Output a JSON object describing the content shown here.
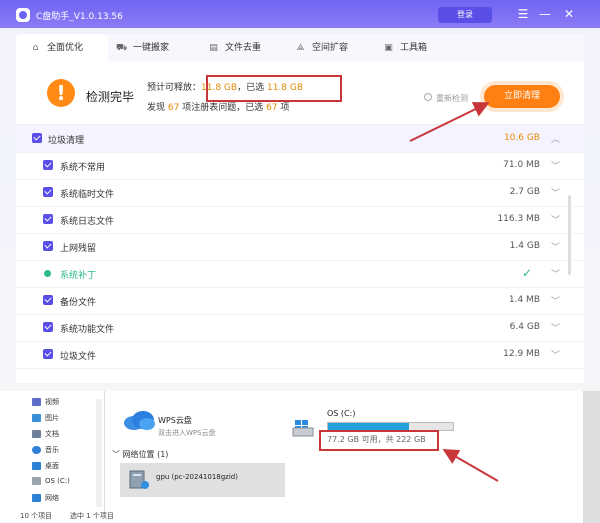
{
  "app": {
    "title": "C盘助手_V1.0.13.56",
    "login_label": "登录",
    "win_buttons": [
      "☰",
      "—",
      "✕"
    ],
    "brand_color": "#6d63f5",
    "accent_color": "#ff7f12"
  },
  "tabs": [
    {
      "label": "全面优化",
      "icon": "home-icon",
      "glyph": "⌂",
      "active": true
    },
    {
      "label": "一键搬家",
      "icon": "truck-icon",
      "glyph": "⛟",
      "active": false
    },
    {
      "label": "文件去重",
      "icon": "file-icon",
      "glyph": "▤",
      "active": false
    },
    {
      "label": "空间扩容",
      "icon": "expand-icon",
      "glyph": "⟁",
      "active": false
    },
    {
      "label": "工具箱",
      "icon": "toolbox-icon",
      "glyph": "▣",
      "active": false
    }
  ],
  "summary": {
    "done_label": "检测完毕",
    "line1": {
      "prefix": "预计可释放：",
      "amount": "11.8 GB",
      "sep": "，已选",
      "selected": "11.8 GB"
    },
    "line2": {
      "prefix": "发现 ",
      "count1": "67",
      "mid": " 项注册表问题，已选 ",
      "count2": "67",
      "suffix": " 项"
    },
    "rescan_label": "重新检测",
    "clean_label": "立即清理"
  },
  "items": [
    {
      "label": "垃圾清理",
      "size": "10.6 GB",
      "type": "cat",
      "chevron": "︿"
    },
    {
      "label": "系统不常用",
      "size": "71.0 MB",
      "type": "check",
      "chevron": "﹀"
    },
    {
      "label": "系统临时文件",
      "size": "2.7 GB",
      "type": "check",
      "chevron": "﹀"
    },
    {
      "label": "系统日志文件",
      "size": "116.3 MB",
      "type": "check",
      "chevron": "﹀"
    },
    {
      "label": "上网残留",
      "size": "1.4 GB",
      "type": "check",
      "chevron": "﹀"
    },
    {
      "label": "系统补丁",
      "size": "",
      "type": "done",
      "chevron": "﹀"
    },
    {
      "label": "备份文件",
      "size": "1.4 MB",
      "type": "check",
      "chevron": "﹀"
    },
    {
      "label": "系统功能文件",
      "size": "6.4 GB",
      "type": "check",
      "chevron": "﹀"
    },
    {
      "label": "垃圾文件",
      "size": "12.9 MB",
      "type": "check",
      "chevron": "﹀"
    }
  ],
  "explorer": {
    "nav": [
      {
        "label": "视频",
        "icon": "video-icon",
        "color": "#5b6cc9"
      },
      {
        "label": "图片",
        "icon": "picture-icon",
        "color": "#3a8fd8"
      },
      {
        "label": "文档",
        "icon": "document-icon",
        "color": "#6f7f9a"
      },
      {
        "label": "音乐",
        "icon": "music-icon",
        "color": "#2f7ed8"
      },
      {
        "label": "桌面",
        "icon": "desktop-icon",
        "color": "#2f7ed8"
      },
      {
        "label": "OS (C:)",
        "icon": "drive-icon",
        "color": "#9aa4ae"
      },
      {
        "label": "网络",
        "icon": "network-icon",
        "color": "#2f7ed8"
      }
    ],
    "wps_name": "WPS云盘",
    "wps_sub": "双击进入WPS云盘",
    "drive_name": "OS (C:)",
    "drive_used_fraction": 0.65,
    "drive_free": "77.2 GB 可用，共 222 GB",
    "network_label": "网络位置 (1)",
    "gpu_name": "gpu (pc-20241018gzid)",
    "status_items": "10 个项目",
    "status_selected": "选中 1 个项目"
  }
}
